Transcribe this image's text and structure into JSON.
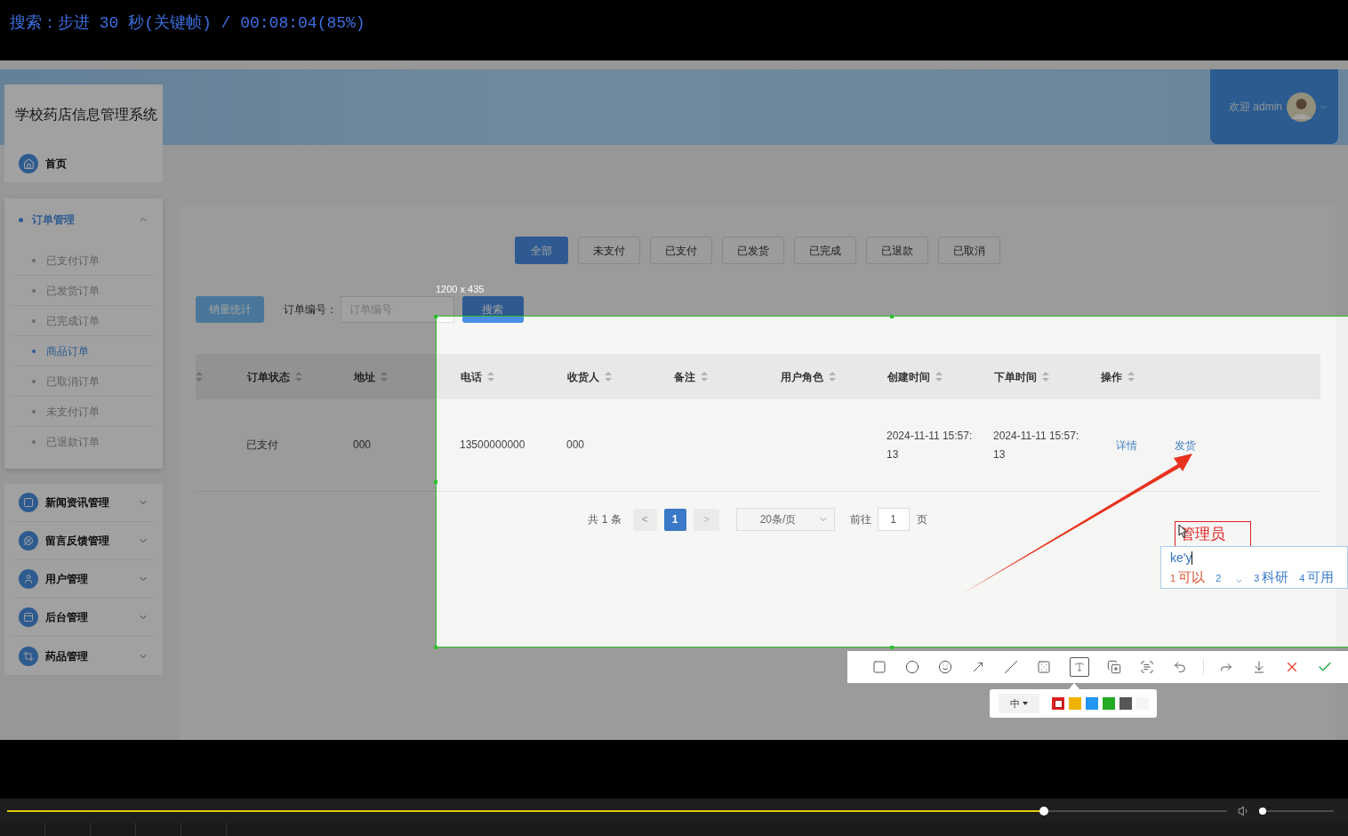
{
  "player": {
    "osd_text": "搜索：步进 30 秒(关键帧) / 00:08:04(85%)",
    "progress": {
      "level": 0.85
    },
    "volume": {
      "level": 0.05
    }
  },
  "app": {
    "title": "学校药店信息管理系统",
    "user": {
      "greeting": "欢迎 admin"
    },
    "home": {
      "label": "首页"
    },
    "menu": [
      {
        "label": "订单管理",
        "expanded": true,
        "children": [
          {
            "label": "已支付订单",
            "selected": false
          },
          {
            "label": "已发货订单",
            "selected": false
          },
          {
            "label": "已完成订单",
            "selected": false
          },
          {
            "label": "商品订单",
            "selected": true
          },
          {
            "label": "已取消订单",
            "selected": false
          },
          {
            "label": "未支付订单",
            "selected": false
          },
          {
            "label": "已退款订单",
            "selected": false
          }
        ]
      },
      {
        "label": "新闻资讯管理",
        "expanded": false
      },
      {
        "label": "留言反馈管理",
        "expanded": false
      },
      {
        "label": "用户管理",
        "expanded": false
      },
      {
        "label": "后台管理",
        "expanded": false
      },
      {
        "label": "药品管理",
        "expanded": false
      }
    ],
    "tabs": [
      {
        "label": "全部",
        "selected": true
      },
      {
        "label": "未支付",
        "selected": false
      },
      {
        "label": "已支付",
        "selected": false
      },
      {
        "label": "已发货",
        "selected": false
      },
      {
        "label": "已完成",
        "selected": false
      },
      {
        "label": "已退款",
        "selected": false
      },
      {
        "label": "已取消",
        "selected": false
      }
    ],
    "search": {
      "stats_button": "销量统计",
      "field_label": "订单编号：",
      "placeholder": "订单编号",
      "button": "搜索"
    },
    "table": {
      "columns": [
        "订单状态",
        "地址",
        "电话",
        "收货人",
        "备注",
        "用户角色",
        "创建时间",
        "下单时间",
        "操作"
      ],
      "rows": [
        {
          "status": "已支付",
          "address": "000",
          "phone": "13500000000",
          "receiver": "000",
          "created": "2024-11-11 15:57:13",
          "ordered": "2024-11-11 15:57:13",
          "actions": [
            "详情",
            "发货"
          ]
        }
      ]
    },
    "pagination": {
      "total": "共 1 条",
      "prev": "<",
      "pages": [
        {
          "label": "1",
          "selected": true
        }
      ],
      "next": ">",
      "page_size": "20条/页",
      "goto_label": "前往",
      "goto_value": "1",
      "goto_suffix": "页"
    }
  },
  "capture": {
    "size_label": "1200 x 435",
    "annotation_text": "管理员",
    "ime": {
      "input": "ke'y",
      "candidates": [
        {
          "index": "1",
          "text": "可以",
          "selected": true
        },
        {
          "index": "2",
          "selected": false
        },
        {
          "index": "3",
          "text": "科研",
          "selected": false
        },
        {
          "index": "4",
          "text": "可用",
          "selected": false
        }
      ]
    },
    "font_size": "中",
    "colors": [
      {
        "color": "#e02020",
        "selected": true
      },
      {
        "color": "#f0b400",
        "selected": false
      },
      {
        "color": "#2196f3",
        "selected": false
      },
      {
        "color": "#22aa22",
        "selected": false
      },
      {
        "color": "#555555",
        "selected": false
      },
      {
        "color": "#f5f5f5",
        "selected": false
      }
    ]
  }
}
